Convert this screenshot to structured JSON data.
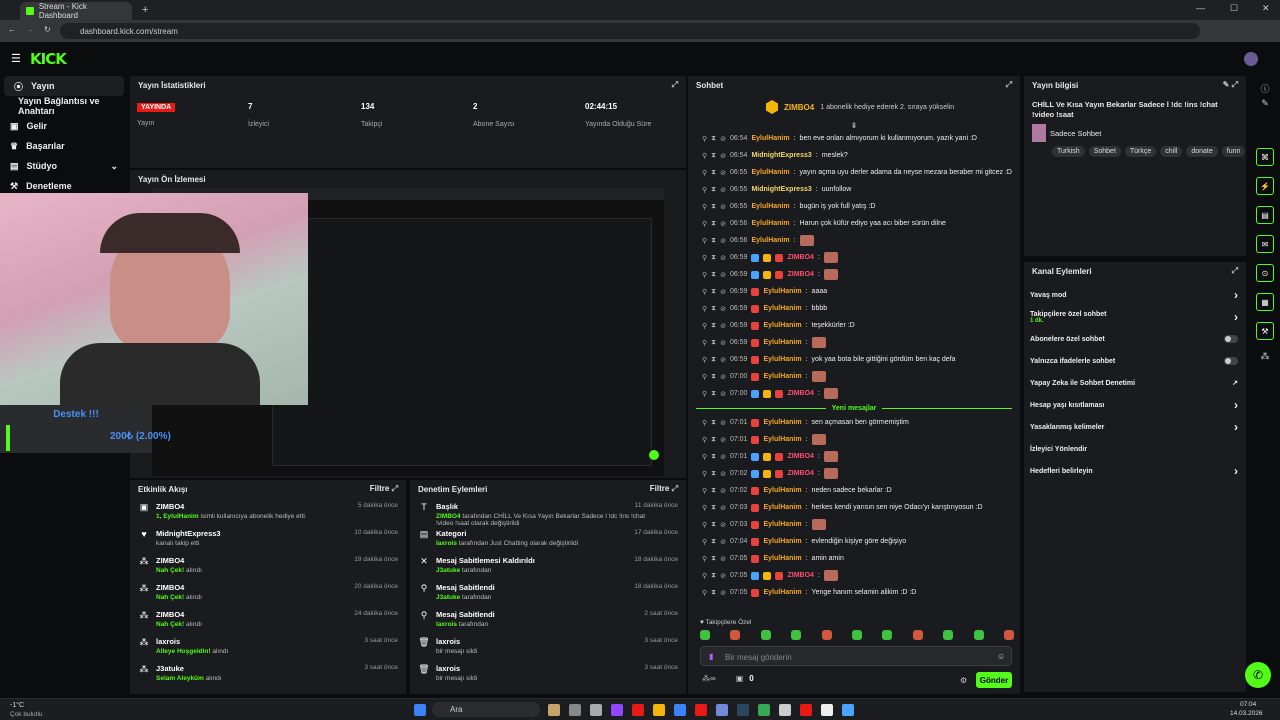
{
  "browser": {
    "tab_title": "Stream - Kick Dashboard",
    "url": "dashboard.kick.com/stream"
  },
  "app": {
    "logo": "KICK"
  },
  "sidebar": {
    "items": [
      {
        "label": "Yayın",
        "icon": "broadcast-icon"
      },
      {
        "label": "Yayın Bağlantısı ve Anahtarı",
        "icon": ""
      },
      {
        "label": "Gelir",
        "icon": "money-icon"
      },
      {
        "label": "Başarılar",
        "icon": "trophy-icon"
      },
      {
        "label": "Stüdyo",
        "icon": "studio-icon"
      },
      {
        "label": "Denetleme",
        "icon": "mod-icon"
      }
    ]
  },
  "stats": {
    "title": "Yayın İstatistikleri",
    "live_badge": "YAYINDA",
    "live_label": "Yayın",
    "viewers": "7",
    "viewers_label": "İzleyici",
    "followers": "134",
    "followers_label": "Takipçi",
    "subs": "2",
    "subs_label": "Abone Sayısı",
    "uptime": "02:44:15",
    "uptime_label": "Yayında Olduğu Süre"
  },
  "preview": {
    "title": "Yayın Ön İzlemesi",
    "donate_title": "Destek !!!",
    "donate_amount": "200₺ (2.00%)"
  },
  "activity": {
    "title": "Etkinlik Akışı",
    "filter": "Filtre",
    "items": [
      {
        "title": "ZIMBO4",
        "sub_hl": "1, EylulHanim",
        "sub": "isimli kullanıcıya abonelik hediye etti.",
        "time": "5 dakika önce",
        "icon": "gift-icon"
      },
      {
        "title": "MidnightExpress3",
        "sub_hl": "",
        "sub": "kanalı takip etti",
        "time": "10 dakika önce",
        "icon": "heart-icon"
      },
      {
        "title": "ZIMBO4",
        "sub_hl": "Nah Çek!",
        "sub": "alındı",
        "time": "19 dakika önce",
        "icon": "reward-icon"
      },
      {
        "title": "ZIMBO4",
        "sub_hl": "Nah Çek!",
        "sub": "alındı",
        "time": "20 dakika önce",
        "icon": "reward-icon"
      },
      {
        "title": "ZIMBO4",
        "sub_hl": "Nah Çek!",
        "sub": "alındı",
        "time": "24 dakika önce",
        "icon": "reward-icon"
      },
      {
        "title": "laxrois",
        "sub_hl": "Alleye Hoşgeldin!",
        "sub": "alındı",
        "time": "3 saat önce",
        "icon": "reward-icon"
      },
      {
        "title": "J3atuke",
        "sub_hl": "Selam Aleyküm",
        "sub": "alındı",
        "time": "3 saat önce",
        "icon": "reward-icon"
      }
    ]
  },
  "modlog": {
    "title": "Denetim Eylemleri",
    "filter": "Filtre",
    "items": [
      {
        "title": "Başlık",
        "sub_hl": "ZIMBO4",
        "sub": "tarafından CHİLL Ve Kısa Yayın Bekarlar Sadece l !dc !ins !chat !video !saat olarak değiştirildi",
        "time": "11 dakika önce",
        "icon": "title-icon"
      },
      {
        "title": "Kategori",
        "sub_hl": "laxrois",
        "sub": "tarafından Just Chatting olarak değiştirildi",
        "time": "17 dakika önce",
        "icon": "category-icon"
      },
      {
        "title": "Mesaj Sabitlemesi Kaldırıldı",
        "sub_hl": "J3atuke",
        "sub": "tarafından",
        "time": "18 dakika önce",
        "icon": "unpin-icon"
      },
      {
        "title": "Mesaj Sabitlendi",
        "sub_hl": "J3atuke",
        "sub": "tarafından",
        "time": "18 dakika önce",
        "icon": "pin-icon"
      },
      {
        "title": "Mesaj Sabitlendi",
        "sub_hl": "laxrois",
        "sub": "tarafından",
        "time": "2 saat önce",
        "icon": "pin-icon"
      },
      {
        "title": "laxrois",
        "sub_hl": "",
        "sub": "bir mesajı sildi",
        "time": "3 saat önce",
        "icon": "trash-icon"
      },
      {
        "title": "laxrois",
        "sub_hl": "",
        "sub": "bir mesajı sildi",
        "time": "3 saat önce",
        "icon": "trash-icon"
      }
    ]
  },
  "chat": {
    "title": "Sohbet",
    "pinned_user": "ZIMBO4",
    "pinned_note": "1 abonelik hediye ederek 2. sıraya yükselin",
    "new_messages": "Yeni mesajlar",
    "followers_only": "Takipçilere Özel",
    "placeholder": "Bir mesaj gönderin",
    "send": "Gönder",
    "count": "0",
    "messages": [
      {
        "time": "06:54",
        "user": "EylulHanim",
        "text": "ben eve onları almıyorum ki kullanmıyorum. yazık yani :D",
        "color": "#f5a623",
        "badges": 0,
        "emote": false
      },
      {
        "time": "06:54",
        "user": "MidnightExpress3",
        "text": "meslek?",
        "color": "#f5d76e",
        "badges": 0,
        "emote": false
      },
      {
        "time": "06:55",
        "user": "EylulHanim",
        "text": "yayın açma uyu derler adama da neyse mezara beraber mi gitcez :D",
        "color": "#f5a623",
        "badges": 0,
        "emote": false
      },
      {
        "time": "06:55",
        "user": "MidnightExpress3",
        "text": "uunfollow",
        "color": "#f5d76e",
        "badges": 0,
        "emote": false
      },
      {
        "time": "06:55",
        "user": "EylulHanim",
        "text": "bugün iş yok full yatış :D",
        "color": "#f5a623",
        "badges": 0,
        "emote": false
      },
      {
        "time": "06:56",
        "user": "EylulHanim",
        "text": "Harun çok küfür ediyo yaa acı biber sürün dilne",
        "color": "#f5a623",
        "badges": 0,
        "emote": false
      },
      {
        "time": "06:56",
        "user": "EylulHanim",
        "text": "",
        "color": "#f5a623",
        "badges": 0,
        "emote": true
      },
      {
        "time": "06:59",
        "user": "ZIMBO4",
        "text": "",
        "color": "#ff4d6d",
        "badges": 3,
        "emote": true
      },
      {
        "time": "06:59",
        "user": "ZIMBO4",
        "text": "",
        "color": "#ff4d6d",
        "badges": 3,
        "emote": true
      },
      {
        "time": "06:59",
        "user": "EylulHanim",
        "text": "aaaa",
        "color": "#f5a623",
        "badges": 1,
        "emote": false
      },
      {
        "time": "06:59",
        "user": "EylulHanim",
        "text": "bbbb",
        "color": "#f5a623",
        "badges": 1,
        "emote": false
      },
      {
        "time": "06:59",
        "user": "EylulHanim",
        "text": "teşekkürler :D",
        "color": "#f5a623",
        "badges": 1,
        "emote": false
      },
      {
        "time": "06:59",
        "user": "EylulHanim",
        "text": "",
        "color": "#f5a623",
        "badges": 1,
        "emote": true
      },
      {
        "time": "06:59",
        "user": "EylulHanim",
        "text": "yok yaa bota bile gittiğini gördüm ben kaç defa",
        "color": "#f5a623",
        "badges": 1,
        "emote": false
      },
      {
        "time": "07:00",
        "user": "EylulHanim",
        "text": "",
        "color": "#f5a623",
        "badges": 1,
        "emote": true
      },
      {
        "time": "07:00",
        "user": "ZIMBO4",
        "text": "",
        "color": "#ff4d6d",
        "badges": 3,
        "emote": true
      }
    ],
    "new": [
      {
        "time": "07:01",
        "user": "EylulHanim",
        "text": "sen açmasan ben görmemiştim",
        "color": "#f5a623",
        "badges": 1,
        "emote": false
      },
      {
        "time": "07:01",
        "user": "EylulHanim",
        "text": "",
        "color": "#f5a623",
        "badges": 1,
        "emote": true
      },
      {
        "time": "07:01",
        "user": "ZIMBO4",
        "text": "",
        "color": "#ff4d6d",
        "badges": 3,
        "emote": true
      },
      {
        "time": "07:02",
        "user": "ZIMBO4",
        "text": "",
        "color": "#ff4d6d",
        "badges": 3,
        "emote": true
      },
      {
        "time": "07:02",
        "user": "EylulHanim",
        "text": "neden sadece bekarlar :D",
        "color": "#f5a623",
        "badges": 1,
        "emote": false
      },
      {
        "time": "07:03",
        "user": "EylulHanim",
        "text": "herkes kendi yarısın sen niye Odacı'yı karıştırıyosun :D",
        "color": "#f5a623",
        "badges": 1,
        "emote": false
      },
      {
        "time": "07:03",
        "user": "EylulHanim",
        "text": "",
        "color": "#f5a623",
        "badges": 1,
        "emote": true
      },
      {
        "time": "07:04",
        "user": "EylulHanim",
        "text": "evlendiğin kişiye göre değişiyo",
        "color": "#f5a623",
        "badges": 1,
        "emote": false
      },
      {
        "time": "07:05",
        "user": "EylulHanim",
        "text": "amin amin",
        "color": "#f5a623",
        "badges": 1,
        "emote": false
      },
      {
        "time": "07:05",
        "user": "ZIMBO4",
        "text": "",
        "color": "#ff4d6d",
        "badges": 3,
        "emote": true
      },
      {
        "time": "07:05",
        "user": "EylulHanim",
        "text": "Yenge hanım selamin alikim :D :D",
        "color": "#f5a623",
        "badges": 1,
        "emote": false
      }
    ]
  },
  "info": {
    "title": "Yayın bilgisi",
    "stream_title": "CHİLL Ve Kısa Yayın Bekarlar Sadece l !dc !ins !chat !video !saat",
    "category": "Sadece Sohbet",
    "tags": [
      "Turkish",
      "Sohbet",
      "Türkçe",
      "chill",
      "donate",
      "funn"
    ]
  },
  "channel_actions": {
    "title": "Kanal Eylemleri",
    "items": [
      {
        "label": "Yavaş mod",
        "sub": "",
        "ctrl": "chevron"
      },
      {
        "label": "Takipçilere özel sohbet",
        "sub": "1 dk.",
        "ctrl": "chevron"
      },
      {
        "label": "Abonelere özel sohbet",
        "sub": "",
        "ctrl": "toggle"
      },
      {
        "label": "Yalnızca ifadelerle sohbet",
        "sub": "",
        "ctrl": "toggle"
      },
      {
        "label": "Yapay Zeka ile Sohbet Denetimi",
        "sub": "",
        "ctrl": "external"
      },
      {
        "label": "Hesap yaşı kısıtlaması",
        "sub": "",
        "ctrl": "chevron"
      },
      {
        "label": "Yasaklanmış kelimeler",
        "sub": "",
        "ctrl": "chevron"
      },
      {
        "label": "İzleyici Yönlendir",
        "sub": "",
        "ctrl": ""
      },
      {
        "label": "Hedefleri belirleyin",
        "sub": "",
        "ctrl": "chevron"
      }
    ]
  },
  "taskbar": {
    "weather_temp": "-1°C",
    "weather_text": "Çok bulutlu",
    "search": "Ara",
    "time": "07:04",
    "date": "14.03.2026"
  },
  "colors": {
    "accent": "#53fc18",
    "live": "#e91916"
  }
}
